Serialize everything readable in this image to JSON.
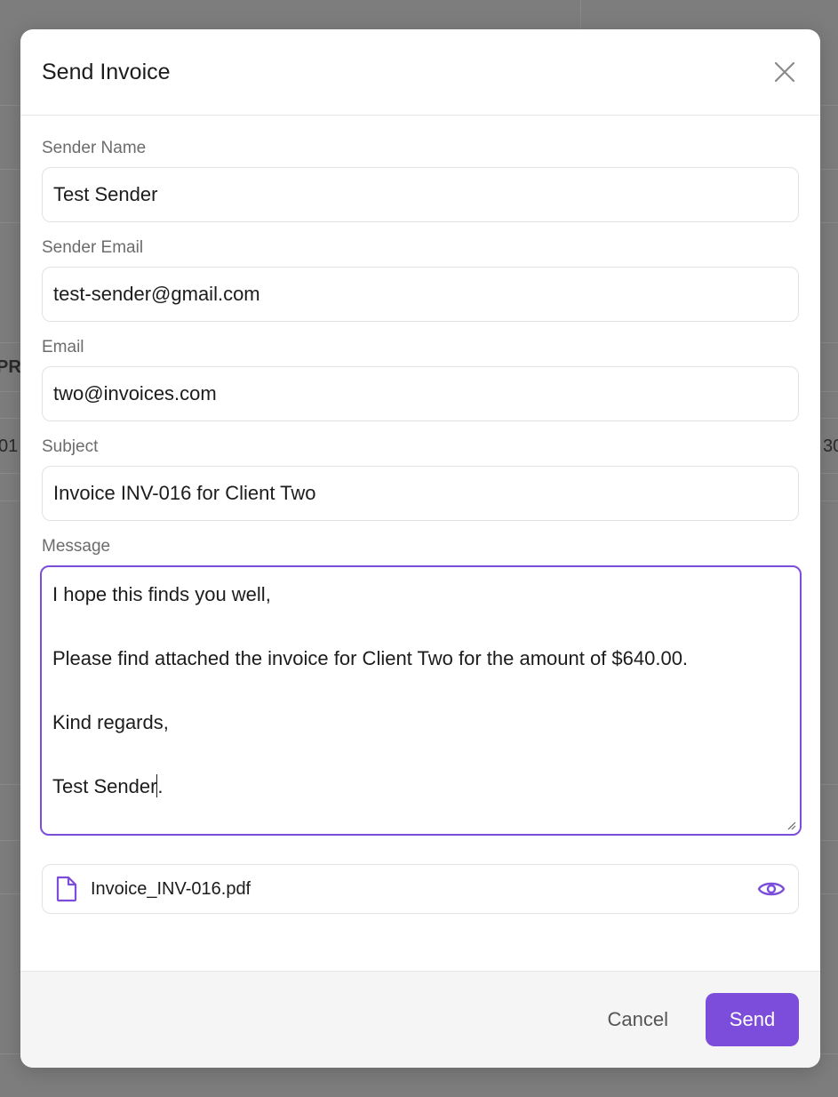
{
  "background": {
    "left_header_fragment": "PR",
    "left_row_fragment": "01",
    "right_row_fragment": "30"
  },
  "modal": {
    "title": "Send Invoice",
    "fields": {
      "sender_name": {
        "label": "Sender Name",
        "value": "Test Sender"
      },
      "sender_email": {
        "label": "Sender Email",
        "value": "test-sender@gmail.com"
      },
      "email": {
        "label": "Email",
        "value": "two@invoices.com"
      },
      "subject": {
        "label": "Subject",
        "value": "Invoice INV-016 for Client Two"
      },
      "message": {
        "label": "Message",
        "lines": [
          "I hope this finds you well,",
          "Please find attached the invoice for Client Two for the amount of $640.00.",
          "Kind regards,",
          "Test Sender."
        ]
      }
    },
    "attachment": {
      "filename": "Invoice_INV-016.pdf"
    },
    "footer": {
      "cancel_label": "Cancel",
      "send_label": "Send"
    }
  },
  "colors": {
    "accent": "#7c4ddb",
    "overlay": "#7d7d7d",
    "footer_bg": "#f5f5f5"
  },
  "icons": {
    "close": "close-icon",
    "file": "file-icon",
    "preview": "eye-icon"
  }
}
